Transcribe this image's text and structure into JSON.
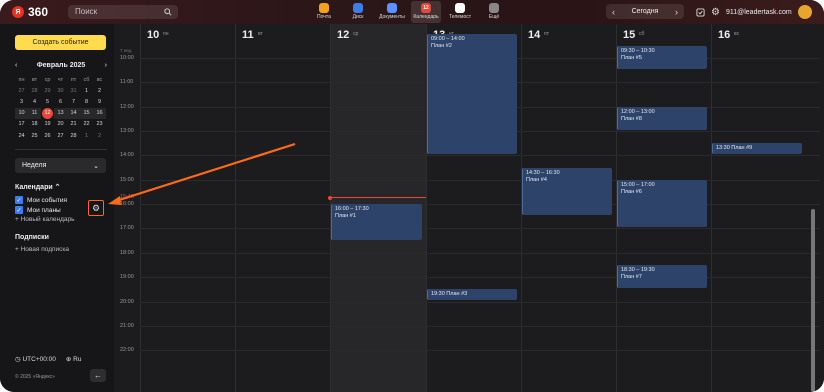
{
  "topbar": {
    "logo_letter": "Я",
    "logo_num": "360",
    "search_placeholder": "Поиск",
    "services": [
      {
        "label": "Почта",
        "color": "#f2a31b"
      },
      {
        "label": "Диск",
        "color": "#3c7ee8"
      },
      {
        "label": "Документы",
        "color": "#5b92ff"
      },
      {
        "label": "Календарь",
        "color": "#e8483a",
        "badge": "12"
      },
      {
        "label": "Телемост",
        "color": "#ffffff"
      },
      {
        "label": "Ещё",
        "color": "#888888"
      }
    ],
    "today_label": "Сегодня",
    "email": "911@leadertask.com"
  },
  "sidebar": {
    "create_label": "Создать событие",
    "month_label": "Февраль 2025",
    "dow": [
      "пн",
      "вт",
      "ср",
      "чт",
      "пт",
      "сб",
      "вс"
    ],
    "weeks": [
      [
        "27",
        "28",
        "29",
        "30",
        "31",
        "1",
        "2"
      ],
      [
        "3",
        "4",
        "5",
        "6",
        "7",
        "8",
        "9"
      ],
      [
        "10",
        "11",
        "12",
        "13",
        "14",
        "15",
        "16"
      ],
      [
        "17",
        "18",
        "19",
        "20",
        "21",
        "22",
        "23"
      ],
      [
        "24",
        "25",
        "26",
        "27",
        "28",
        "1",
        "2"
      ]
    ],
    "view_select": "Неделя",
    "calendars_title": "Календари",
    "calendars": [
      "Мои события",
      "Мои планы"
    ],
    "new_calendar": "Новый календарь",
    "subs_title": "Подписки",
    "new_sub": "Новая подписка",
    "timezone": "UTC+00:00",
    "lang": "Ru",
    "copyright": "© 2025 «Яндекс»"
  },
  "calendar": {
    "week_label": "7 нед.",
    "days": [
      {
        "num": "10",
        "name": "пн"
      },
      {
        "num": "11",
        "name": "вт"
      },
      {
        "num": "12",
        "name": "ср"
      },
      {
        "num": "13",
        "name": "чт"
      },
      {
        "num": "14",
        "name": "пт"
      },
      {
        "num": "15",
        "name": "сб"
      },
      {
        "num": "16",
        "name": "вс"
      }
    ],
    "hours": [
      "09:00",
      "10:00",
      "11:00",
      "12:00",
      "13:00",
      "14:00",
      "15:00",
      "16:00",
      "17:00",
      "18:00",
      "19:00",
      "20:00",
      "21:00",
      "22:00"
    ],
    "now_label": "15:43",
    "events": [
      {
        "day": 3,
        "time": "09:00 – 14:00",
        "title": "План #2",
        "start": 9.0,
        "end": 14.0
      },
      {
        "day": 2,
        "time": "16:00 – 17:30",
        "title": "План #1",
        "start": 16.0,
        "end": 17.5
      },
      {
        "day": 3,
        "time": "",
        "title": "19:30 План #3",
        "start": 19.5,
        "end": 20.0
      },
      {
        "day": 4,
        "time": "14:30 – 16:30",
        "title": "План #4",
        "start": 14.5,
        "end": 16.5
      },
      {
        "day": 5,
        "time": "09:30 – 10:30",
        "title": "План #5",
        "start": 9.5,
        "end": 10.5
      },
      {
        "day": 5,
        "time": "12:00 – 13:00",
        "title": "План #8",
        "start": 12.0,
        "end": 13.0
      },
      {
        "day": 5,
        "time": "15:00 – 17:00",
        "title": "План #6",
        "start": 15.0,
        "end": 17.0
      },
      {
        "day": 5,
        "time": "18:30 – 19:30",
        "title": "План #7",
        "start": 18.5,
        "end": 19.5
      },
      {
        "day": 6,
        "time": "",
        "title": "13:30 План #9",
        "start": 13.5,
        "end": 14.0
      }
    ]
  }
}
